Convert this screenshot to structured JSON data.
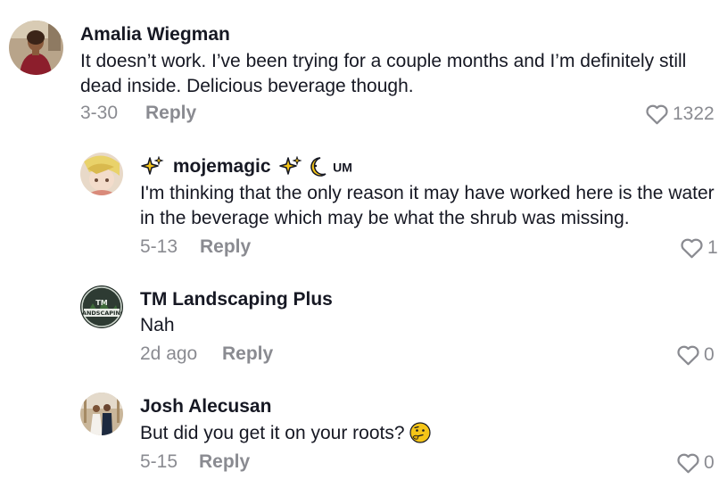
{
  "comments": [
    {
      "username": "Amalia Wiegman",
      "text": "It doesn’t work. I’ve been trying for a couple months and I’m definitely still dead inside. Delicious beverage though.",
      "date": "3-30",
      "reply_label": "Reply",
      "likes": "1322",
      "avatar_icon": "woman-in-red-avatar"
    },
    {
      "username": "mojemagic",
      "badge": "UM",
      "text": "I'm thinking that the only reason it may have worked here is the water in the beverage which may be what the shrub was missing.",
      "date": "5-13",
      "reply_label": "Reply",
      "likes": "1",
      "avatar_icon": "anime-character-avatar"
    },
    {
      "username": "TM Landscaping Plus",
      "text": "Nah",
      "date": "2d ago",
      "reply_label": "Reply",
      "likes": "0",
      "avatar_icon": "landscaping-logo-avatar"
    },
    {
      "username": "Josh Alecusan",
      "text": "But did you get it on your roots?",
      "date": "5-15",
      "reply_label": "Reply",
      "likes": "0",
      "avatar_icon": "wedding-couple-avatar"
    }
  ],
  "colors": {
    "text_primary": "#161823",
    "text_secondary": "#8a8b91",
    "background": "#ffffff",
    "sparkle": "#f5c518"
  },
  "icons": [
    "heart-outline-icon",
    "sparkle-icon",
    "moon-face-emoji",
    "thinking-face-emoji"
  ]
}
